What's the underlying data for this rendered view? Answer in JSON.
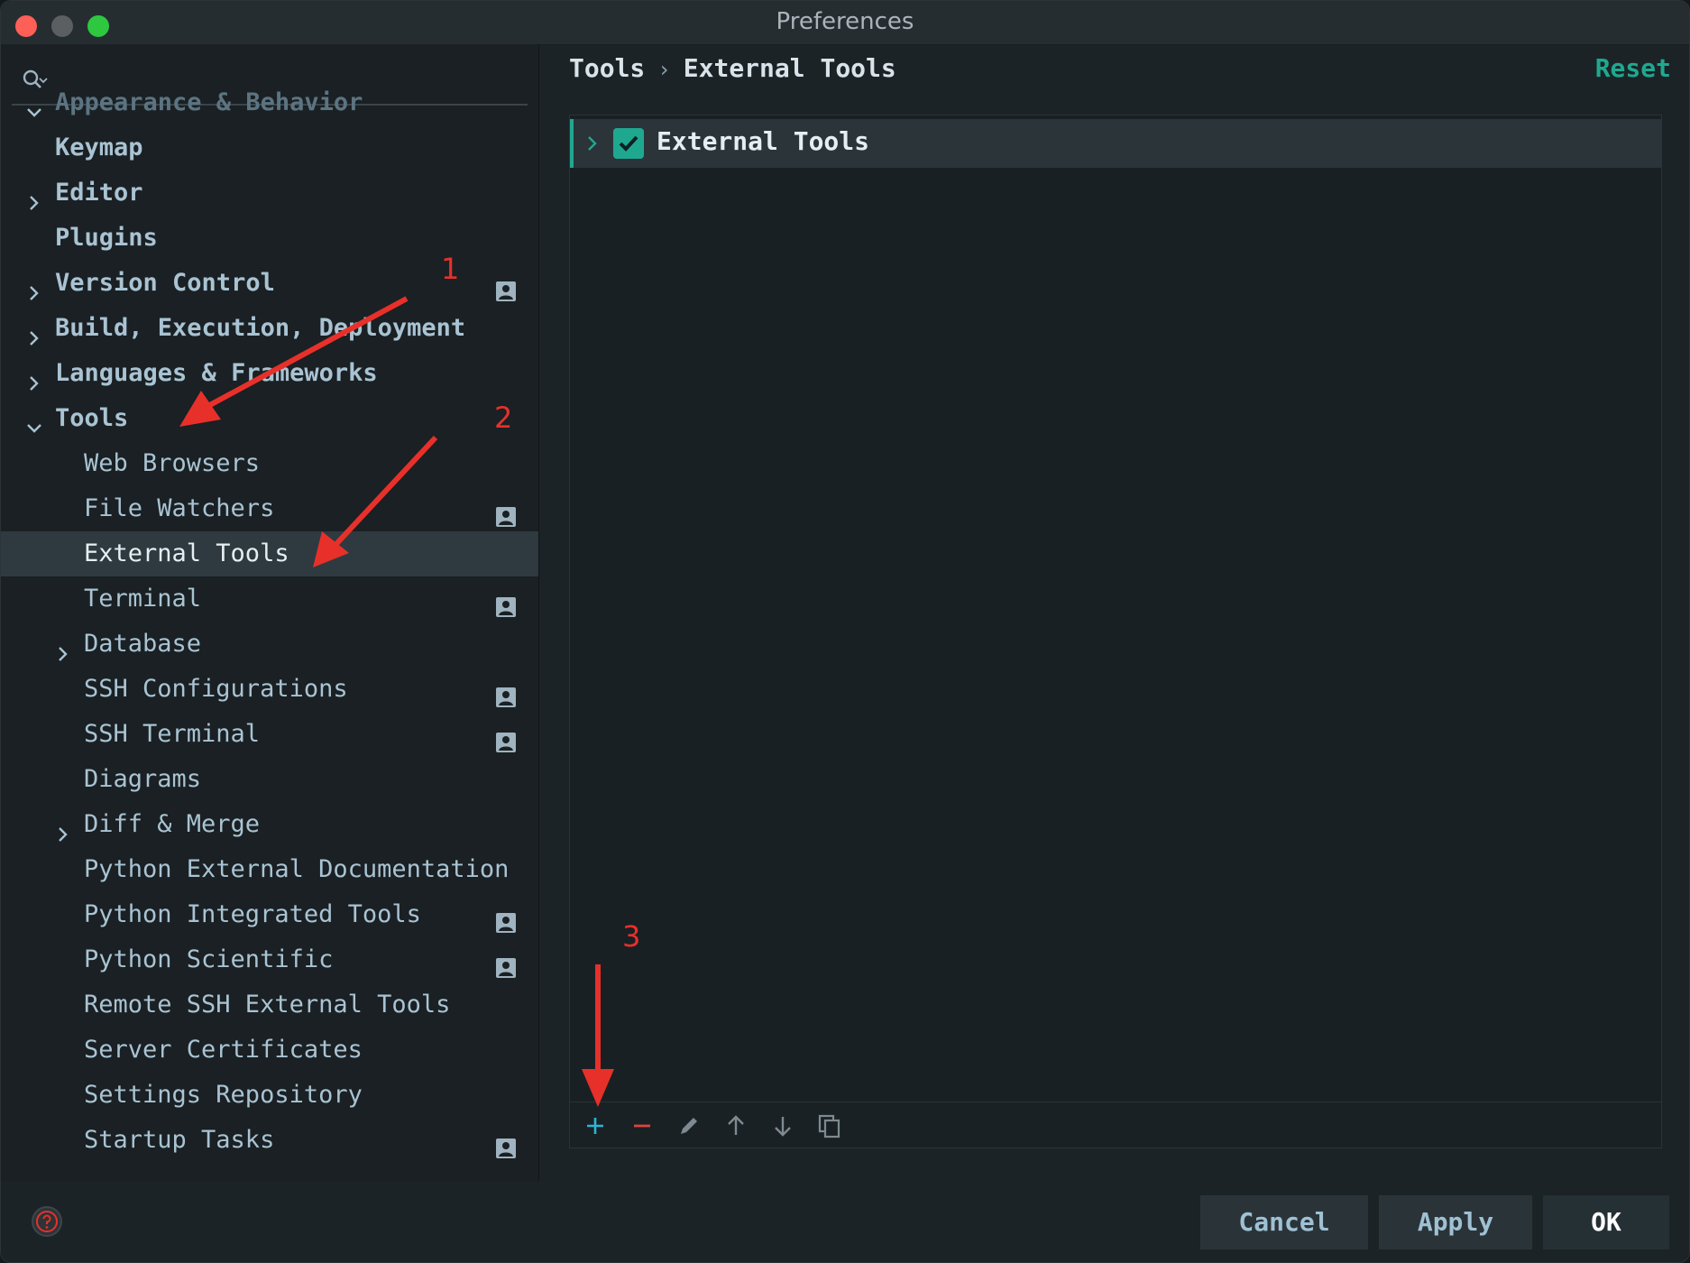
{
  "window": {
    "title": "Preferences"
  },
  "search": {
    "placeholder": "",
    "value": ""
  },
  "sidebar": {
    "items": [
      {
        "label": "Appearance & Behavior",
        "level": 0,
        "expanded": true,
        "bold": true,
        "partial": true
      },
      {
        "label": "Keymap",
        "level": 0,
        "bold": true
      },
      {
        "label": "Editor",
        "level": 0,
        "collapsible": true,
        "bold": true
      },
      {
        "label": "Plugins",
        "level": 0,
        "bold": true
      },
      {
        "label": "Version Control",
        "level": 0,
        "collapsible": true,
        "bold": true,
        "badge": true
      },
      {
        "label": "Build, Execution, Deployment",
        "level": 0,
        "collapsible": true,
        "bold": true
      },
      {
        "label": "Languages & Frameworks",
        "level": 0,
        "collapsible": true,
        "bold": true
      },
      {
        "label": "Tools",
        "level": 0,
        "expanded": true,
        "bold": true
      },
      {
        "label": "Web Browsers",
        "level": 1
      },
      {
        "label": "File Watchers",
        "level": 1,
        "badge": true
      },
      {
        "label": "External Tools",
        "level": 1,
        "selected": true
      },
      {
        "label": "Terminal",
        "level": 1,
        "badge": true
      },
      {
        "label": "Database",
        "level": 1,
        "collapsible": true
      },
      {
        "label": "SSH Configurations",
        "level": 1,
        "badge": true
      },
      {
        "label": "SSH Terminal",
        "level": 1,
        "badge": true
      },
      {
        "label": "Diagrams",
        "level": 1
      },
      {
        "label": "Diff & Merge",
        "level": 1,
        "collapsible": true
      },
      {
        "label": "Python External Documentation",
        "level": 1
      },
      {
        "label": "Python Integrated Tools",
        "level": 1,
        "badge": true
      },
      {
        "label": "Python Scientific",
        "level": 1,
        "badge": true
      },
      {
        "label": "Remote SSH External Tools",
        "level": 1
      },
      {
        "label": "Server Certificates",
        "level": 1
      },
      {
        "label": "Settings Repository",
        "level": 1
      },
      {
        "label": "Startup Tasks",
        "level": 1,
        "badge": true
      }
    ]
  },
  "main": {
    "breadcrumb": [
      "Tools",
      "External Tools"
    ],
    "reset_label": "Reset",
    "group": {
      "label": "External Tools",
      "checked": true
    },
    "toolbar": [
      "add-icon",
      "remove-icon",
      "edit-icon",
      "move-up-icon",
      "move-down-icon",
      "copy-icon"
    ]
  },
  "footer": {
    "cancel_label": "Cancel",
    "apply_label": "Apply",
    "ok_label": "OK"
  },
  "annotations": {
    "labels": [
      "1",
      "2",
      "3"
    ],
    "color": "#e8302a"
  },
  "colors": {
    "accent": "#1fa890",
    "selection": "#2e3a40"
  }
}
